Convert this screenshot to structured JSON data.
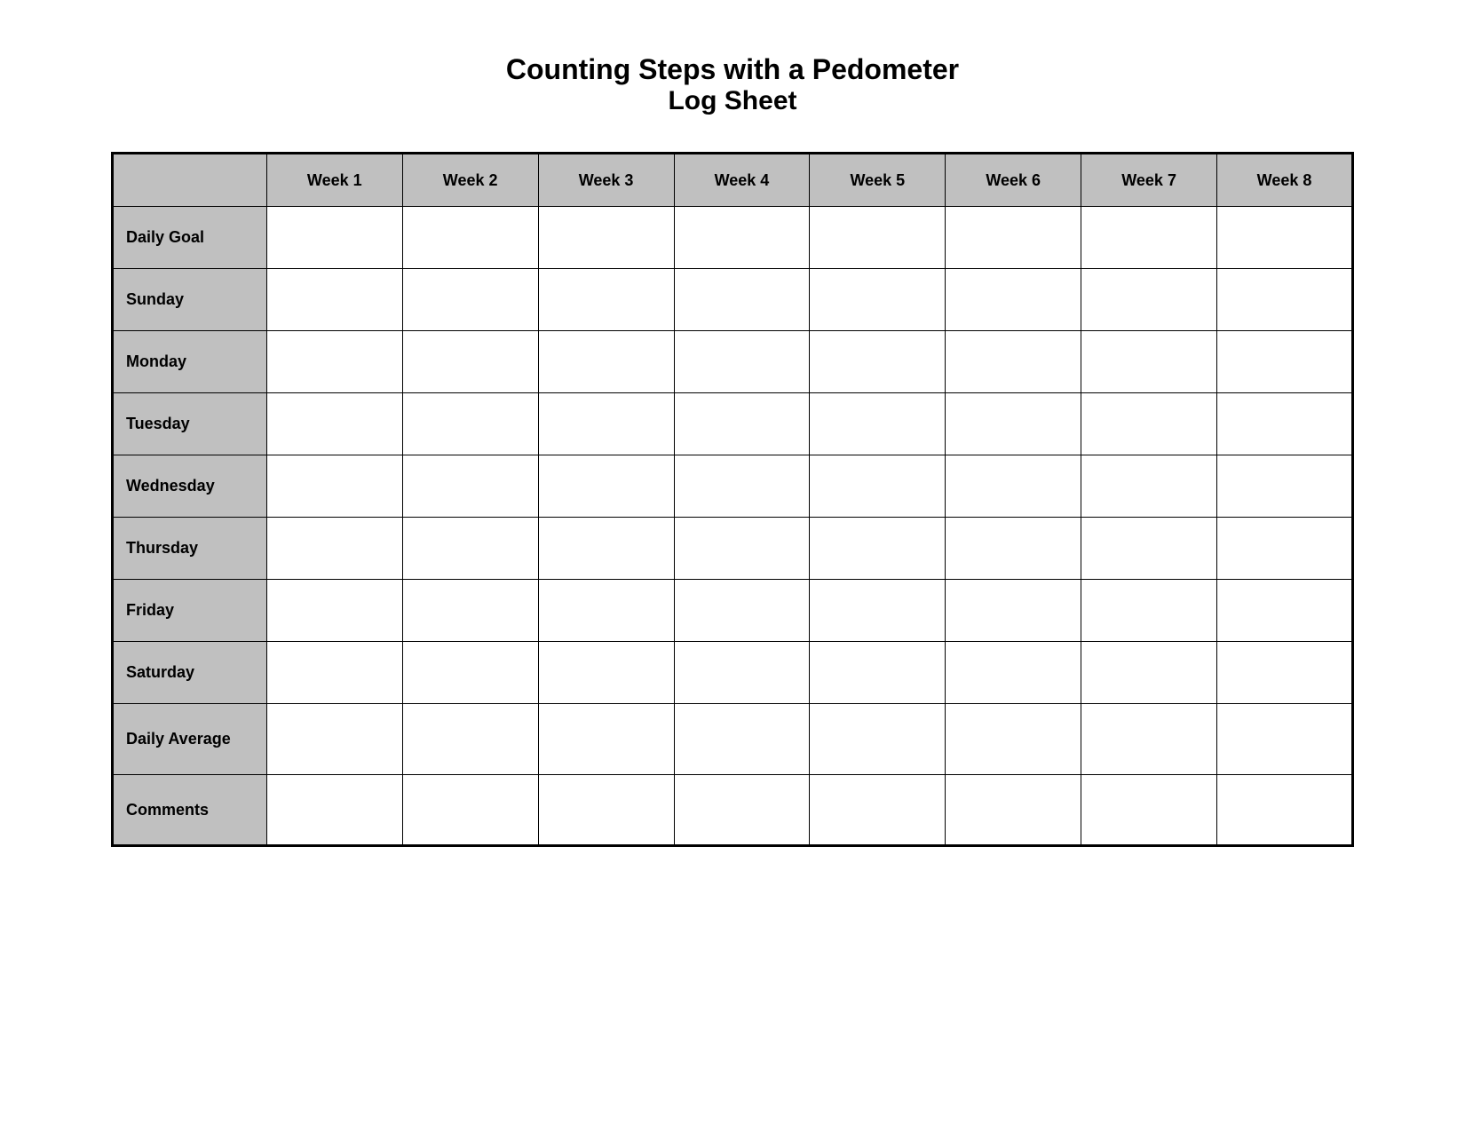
{
  "title": {
    "main": "Counting Steps with a Pedometer",
    "sub": "Log Sheet"
  },
  "table": {
    "header": {
      "empty": "",
      "weeks": [
        "Week 1",
        "Week 2",
        "Week 3",
        "Week 4",
        "Week 5",
        "Week 6",
        "Week 7",
        "Week 8"
      ]
    },
    "rows": [
      {
        "label": "Daily Goal"
      },
      {
        "label": "Sunday"
      },
      {
        "label": "Monday"
      },
      {
        "label": "Tuesday"
      },
      {
        "label": "Wednesday"
      },
      {
        "label": "Thursday"
      },
      {
        "label": "Friday"
      },
      {
        "label": "Saturday"
      },
      {
        "label": "Daily Average",
        "class": "daily-average"
      },
      {
        "label": "Comments",
        "class": "comments"
      }
    ]
  }
}
